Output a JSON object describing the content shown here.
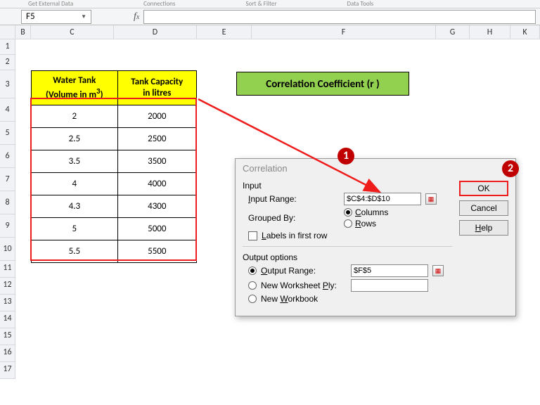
{
  "ribbon_groups": [
    "Get External Data",
    "Connections",
    "Sort & Filter",
    "Data Tools"
  ],
  "namebox": {
    "value": "F5"
  },
  "title_box": "Correlation Coefficient (r )",
  "columns": [
    "",
    "B",
    "C",
    "D",
    "E",
    "F",
    "G",
    "H",
    "K"
  ],
  "table": {
    "header1_line1": "Water Tank",
    "header1_line2": "(Volume in m",
    "header1_sup": "3",
    "header1_close": ")",
    "header2_line1": "Tank Capacity",
    "header2_line2": "in litres",
    "rows": [
      {
        "vol": "2",
        "cap": "2000"
      },
      {
        "vol": "2.5",
        "cap": "2500"
      },
      {
        "vol": "3.5",
        "cap": "3500"
      },
      {
        "vol": "4",
        "cap": "4000"
      },
      {
        "vol": "4.3",
        "cap": "4300"
      },
      {
        "vol": "5",
        "cap": "5000"
      },
      {
        "vol": "5.5",
        "cap": "5500"
      }
    ]
  },
  "dialog": {
    "title": "Correlation",
    "input_label": "Input",
    "input_range_label": "Input Range:",
    "input_range_value": "$C$4:$D$10",
    "grouped_label": "Grouped By:",
    "columns_label": "Columns",
    "rows_label": "Rows",
    "labels_first_row": "Labels in first row",
    "output_label": "Output options",
    "output_range_label": "Output Range:",
    "output_range_value": "$F$5",
    "new_sheet_label": "New Worksheet Ply:",
    "new_book_label": "New Workbook",
    "ok": "OK",
    "cancel": "Cancel",
    "help": "Help"
  },
  "callouts": {
    "one": "1",
    "two": "2"
  },
  "chart_data": {
    "type": "table",
    "title": "Correlation Coefficient (r )",
    "columns": [
      "Water Tank (Volume in m^3)",
      "Tank Capacity in litres"
    ],
    "rows": [
      [
        2,
        2000
      ],
      [
        2.5,
        2500
      ],
      [
        3.5,
        3500
      ],
      [
        4,
        4000
      ],
      [
        4.3,
        4300
      ],
      [
        5,
        5000
      ],
      [
        5.5,
        5500
      ]
    ]
  }
}
